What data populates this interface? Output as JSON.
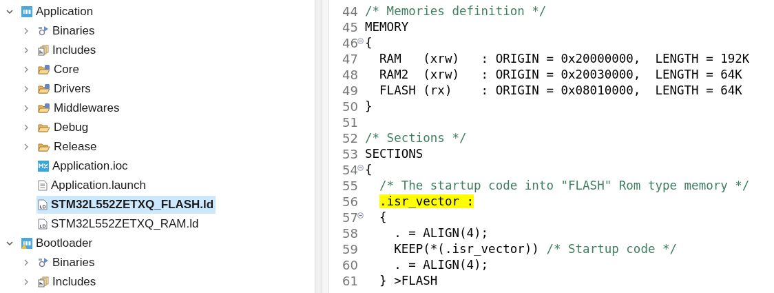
{
  "project_tree": [
    {
      "label": "Application",
      "kind": "project",
      "expanded": true,
      "selected": false,
      "children": [
        {
          "label": "Binaries",
          "kind": "binaries",
          "expanded": false,
          "selected": false
        },
        {
          "label": "Includes",
          "kind": "includes",
          "expanded": false,
          "selected": false
        },
        {
          "label": "Core",
          "kind": "source-folder",
          "expanded": false,
          "selected": false
        },
        {
          "label": "Drivers",
          "kind": "source-folder",
          "expanded": false,
          "selected": false
        },
        {
          "label": "Middlewares",
          "kind": "source-folder",
          "expanded": false,
          "selected": false
        },
        {
          "label": "Debug",
          "kind": "folder",
          "expanded": false,
          "selected": false
        },
        {
          "label": "Release",
          "kind": "folder",
          "expanded": false,
          "selected": false
        },
        {
          "label": "Application.ioc",
          "kind": "mx",
          "selected": false
        },
        {
          "label": "Application.launch",
          "kind": "launch",
          "selected": false
        },
        {
          "label": "STM32L552ZETXQ_FLASH.ld",
          "kind": "ld",
          "selected": true
        },
        {
          "label": "STM32L552ZETXQ_RAM.ld",
          "kind": "ld",
          "selected": false
        }
      ]
    },
    {
      "label": "Bootloader",
      "kind": "project-warning",
      "expanded": true,
      "selected": false,
      "children": [
        {
          "label": "Binaries",
          "kind": "binaries",
          "expanded": false,
          "selected": false
        },
        {
          "label": "Includes",
          "kind": "includes",
          "expanded": false,
          "selected": false
        }
      ]
    }
  ],
  "editor_lines": [
    {
      "number": "44",
      "foldable": false,
      "segments": [
        {
          "kind": "comment",
          "text": "/* Memories definition */"
        }
      ]
    },
    {
      "number": "45",
      "foldable": false,
      "segments": [
        {
          "kind": "code",
          "text": "MEMORY"
        }
      ]
    },
    {
      "number": "46",
      "foldable": true,
      "segments": [
        {
          "kind": "code",
          "text": "{"
        }
      ]
    },
    {
      "number": "47",
      "foldable": false,
      "segments": [
        {
          "kind": "code",
          "text": "  RAM   (xrw)   : ORIGIN = 0x20000000,  LENGTH = 192K"
        }
      ]
    },
    {
      "number": "48",
      "foldable": false,
      "segments": [
        {
          "kind": "code",
          "text": "  RAM2  (xrw)   : ORIGIN = 0x20030000,  LENGTH = 64K"
        }
      ]
    },
    {
      "number": "49",
      "foldable": false,
      "segments": [
        {
          "kind": "code",
          "text": "  FLASH (rx)    : ORIGIN = 0x08010000,  LENGTH = 64K"
        }
      ]
    },
    {
      "number": "50",
      "foldable": false,
      "segments": [
        {
          "kind": "code",
          "text": "}"
        }
      ]
    },
    {
      "number": "51",
      "foldable": false
    },
    {
      "number": "52",
      "foldable": false,
      "segments": [
        {
          "kind": "comment",
          "text": "/* Sections */"
        }
      ]
    },
    {
      "number": "53",
      "foldable": false,
      "segments": [
        {
          "kind": "code",
          "text": "SECTIONS"
        }
      ]
    },
    {
      "number": "54",
      "foldable": true,
      "segments": [
        {
          "kind": "code",
          "text": "{"
        }
      ]
    },
    {
      "number": "55",
      "foldable": false,
      "segments": [
        {
          "kind": "comment",
          "text": "  /* The startup code into \"FLASH\" Rom type memory */"
        }
      ]
    },
    {
      "number": "56",
      "foldable": false,
      "segments": [
        {
          "kind": "highlight",
          "text": "  .isr_vector :"
        }
      ]
    },
    {
      "number": "57",
      "foldable": true,
      "segments": [
        {
          "kind": "code",
          "text": "  {"
        }
      ]
    },
    {
      "number": "58",
      "foldable": false,
      "segments": [
        {
          "kind": "code",
          "text": "    . = ALIGN(4);"
        }
      ]
    },
    {
      "number": "59",
      "foldable": false,
      "segments": [
        {
          "kind": "code",
          "text": "    KEEP(*(.isr_vector)) "
        },
        {
          "kind": "comment",
          "text": "/* Startup code */"
        }
      ]
    },
    {
      "number": "60",
      "foldable": false,
      "segments": [
        {
          "kind": "code",
          "text": "    . = ALIGN(4);"
        }
      ]
    },
    {
      "number": "61",
      "foldable": false,
      "segments": [
        {
          "kind": "code",
          "text": "  } >FLASH"
        }
      ]
    }
  ]
}
